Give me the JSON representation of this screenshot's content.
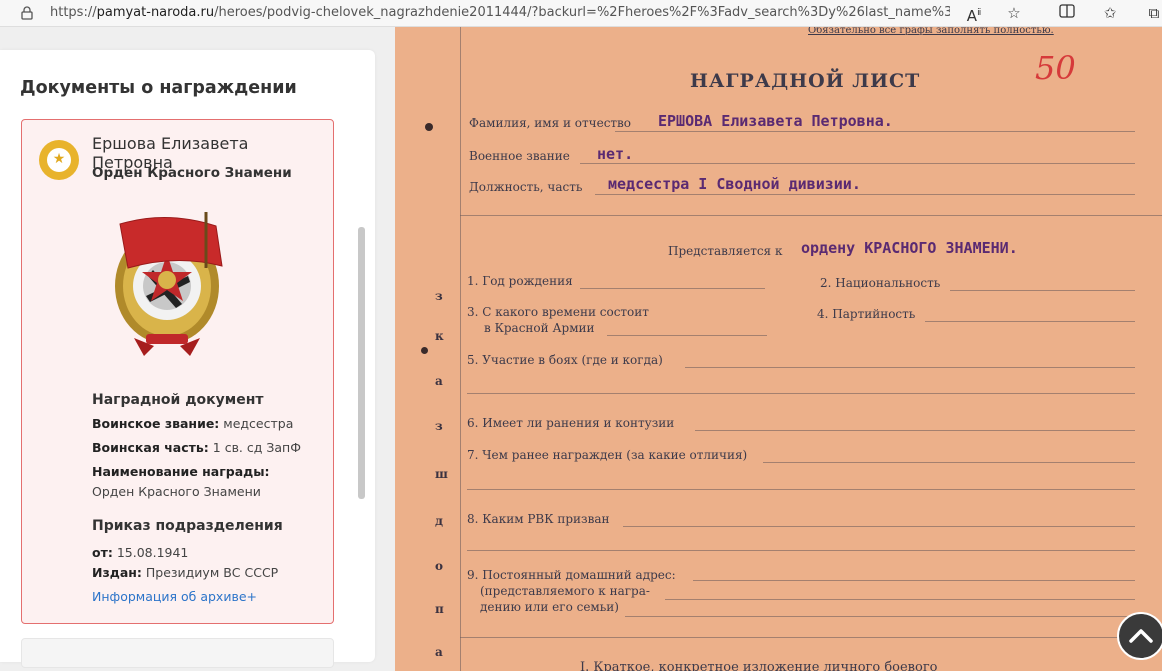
{
  "browser": {
    "url_prefix": "https://",
    "url_host": "pamyat-naroda.ru",
    "url_path": "/heroes/podvig-chelovek_nagrazhdenie2011444/?backurl=%2Fheroes%2F%3Fadv_search%3Dy%26last_name%3DЕрш..."
  },
  "panel": {
    "title": "Документы о награждении",
    "person": {
      "name": "Ершова Елизавета Петровна",
      "award": "Орден Красного Знамени"
    },
    "award_doc": {
      "title": "Наградной документ",
      "rank_label": "Воинское звание:",
      "rank_value": " медсестра",
      "unit_label": "Воинская часть:",
      "unit_value": " 1 св. сд ЗапФ",
      "award_name_label": "Наименование награды:",
      "award_name_value": " Орден Красного Знамени"
    },
    "order": {
      "title": "Приказ подразделения",
      "from_label": "от:",
      "from_value": " 15.08.1941",
      "issued_label": "Издан:",
      "issued_value": " Президиум ВС СССР"
    },
    "archive_link": "Информация об архиве+"
  },
  "document": {
    "top_note": "Обязательно все графы заполнять полностью.",
    "title": "НАГРАДНОЙ ЛИСТ",
    "handwritten_number": "50",
    "fio_label": "Фамилия, имя и отчество",
    "fio_value": "ЕРШОВА Елизавета Петровна.",
    "rank_label": "Военное звание",
    "rank_value": "нет.",
    "position_label": "Должность, часть",
    "position_value": "медсестра I  Сводной дивизии.",
    "presented_label": "Представляется к",
    "presented_value": "ордену КРАСНОГО ЗНАМЕНИ.",
    "items": {
      "i1": "1. Год рождения",
      "i2": "2. Национальность",
      "i3a": "3. С какого времени состоит",
      "i3b": "в Красной Армии",
      "i4": "4. Партийность",
      "i5": "5. Участие в боях (где и когда)",
      "i6": "6. Имеет ли ранения и контузии",
      "i7": "7. Чем ранее награжден (за какие отличия)",
      "i8": "8. Каким РВК призван",
      "i9a": "9. Постоянный домашний адрес:",
      "i9b": "(представляемого к награ-",
      "i9c": "дению или его семьи)",
      "i10": "I. Краткое, конкретное изложение личного боевого"
    },
    "side_marks": [
      "з",
      "к",
      "а",
      "з",
      "ш",
      "д",
      "о",
      "п",
      "а"
    ]
  },
  "colors": {
    "accent_link": "#2c74c9",
    "card_border": "#e46f6f",
    "card_bg": "#fdf1f1",
    "paper": "#ecb08a",
    "typewriter_ink": "#5a2a72"
  }
}
